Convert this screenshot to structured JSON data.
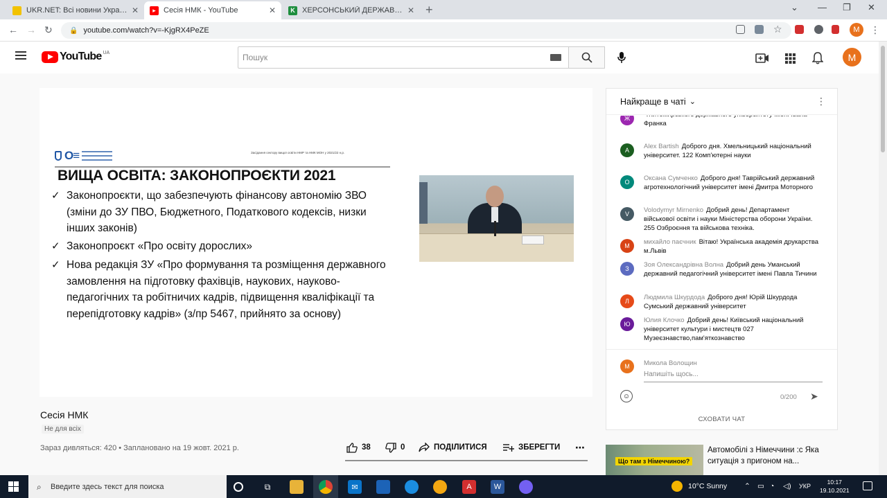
{
  "browser": {
    "tabs": [
      {
        "title": "UKR.NET: Всі новини України, о",
        "favicon_color": "#f2c200"
      },
      {
        "title": "Сесія НМК - YouTube",
        "favicon_color": "#ff0000"
      },
      {
        "title": "ХЕРСОНСЬКИЙ ДЕРЖАВНИЙ АГ",
        "favicon_color": "#1e8e3e"
      }
    ],
    "url": "youtube.com/watch?v=-KjgRX4PeZE",
    "profile_initial": "M"
  },
  "youtube": {
    "logo_text": "YouTube",
    "country_code": "UA",
    "search_placeholder": "Пошук",
    "avatar_initial": "M"
  },
  "slide": {
    "header_note": "Засідання сектору вищої освіти НМР та НМК МОН у 2021/22 н.р.",
    "title": "ВИЩА ОСВІТА: ЗАКОНОПРОЄКТИ 2021",
    "bullets": [
      "Законопроєкти, що забезпечують фінансову автономію ЗВО (зміни до ЗУ ПВО, Бюджетного, Податкового кодексів, низки інших законів)",
      "Законопроєкт «Про освіту дорослих»",
      "Нова редакція ЗУ «Про формування та розміщення державного замовлення на підготовку фахівців, наукових, науково-педагогічних та робітничих кадрів, підвищення кваліфікації та перепідготовку кадрів» (з/пр 5467, прийнято за основу)"
    ]
  },
  "video": {
    "title": "Сесія НМК",
    "visibility": "Не для всіх",
    "meta": "Зараз дивляться: 420 • Заплановано на 19 жовт. 2021 р.",
    "likes": "38",
    "dislikes": "0",
    "share_label": "ПОДІЛИТИСЯ",
    "save_label": "ЗБЕРЕГТИ"
  },
  "chat": {
    "header": "Найкраще в чаті",
    "messages": [
      {
        "initial": "Ж",
        "color": "#9c27b0",
        "author": "",
        "text": "Житомирського державного університету імені Івана Франка"
      },
      {
        "initial": "A",
        "color": "#1b5e20",
        "author": "Alex Bartish",
        "text": "Доброго дня. Хмельницький національний університет. 122 Комп'ютерні науки"
      },
      {
        "initial": "O",
        "color": "#00897b",
        "author": "Оксана Сумченко",
        "text": "Доброго дня! Таврійський державний агротехнологічний університет імені Дмитра Моторного"
      },
      {
        "initial": "V",
        "color": "#455a64",
        "author": "Volodymyr Mirnenko",
        "text": "Добрий день! Департамент військової освіти і науки Міністерства оборони України. 255 Озброєння та військова техніка."
      },
      {
        "initial": "M",
        "color": "#d84315",
        "author": "михайло паєчник",
        "text": "Вітаю! Українська академія друкарства м.Львів"
      },
      {
        "initial": "З",
        "color": "#5c6bc0",
        "author": "Зоя Олександрівна Волна",
        "text": "Добрий день Уманський державний педагогічний університет імені Павла Тичини"
      },
      {
        "initial": "Л",
        "color": "#e64a19",
        "author": "Людмила Шкурдода",
        "text": "Доброго дня! Юрій Шкурдода Сумський державний університет"
      },
      {
        "initial": "Ю",
        "color": "#6a1b9a",
        "author": "Юлия Клочко",
        "text": "Добрий день! Київський національний університет культури і мистецтв 027 Музеєзнавство,пам'яткознавство"
      }
    ],
    "input_name": "Микола Волощин",
    "input_placeholder": "Напишіть щось...",
    "char_count": "0/200",
    "hide_label": "СХОВАТИ ЧАТ"
  },
  "recommendation": {
    "thumb_text": "Що там з Німеччиною?",
    "title": "Автомобілі з Німеччини :с Яка ситуація з пригоном на...",
    "channel": ""
  },
  "taskbar": {
    "search_text": "Введите здесь текст для поиска",
    "weather": "10°C  Sunny",
    "language": "УКР",
    "time": "10:17",
    "date": "19.10.2021"
  }
}
